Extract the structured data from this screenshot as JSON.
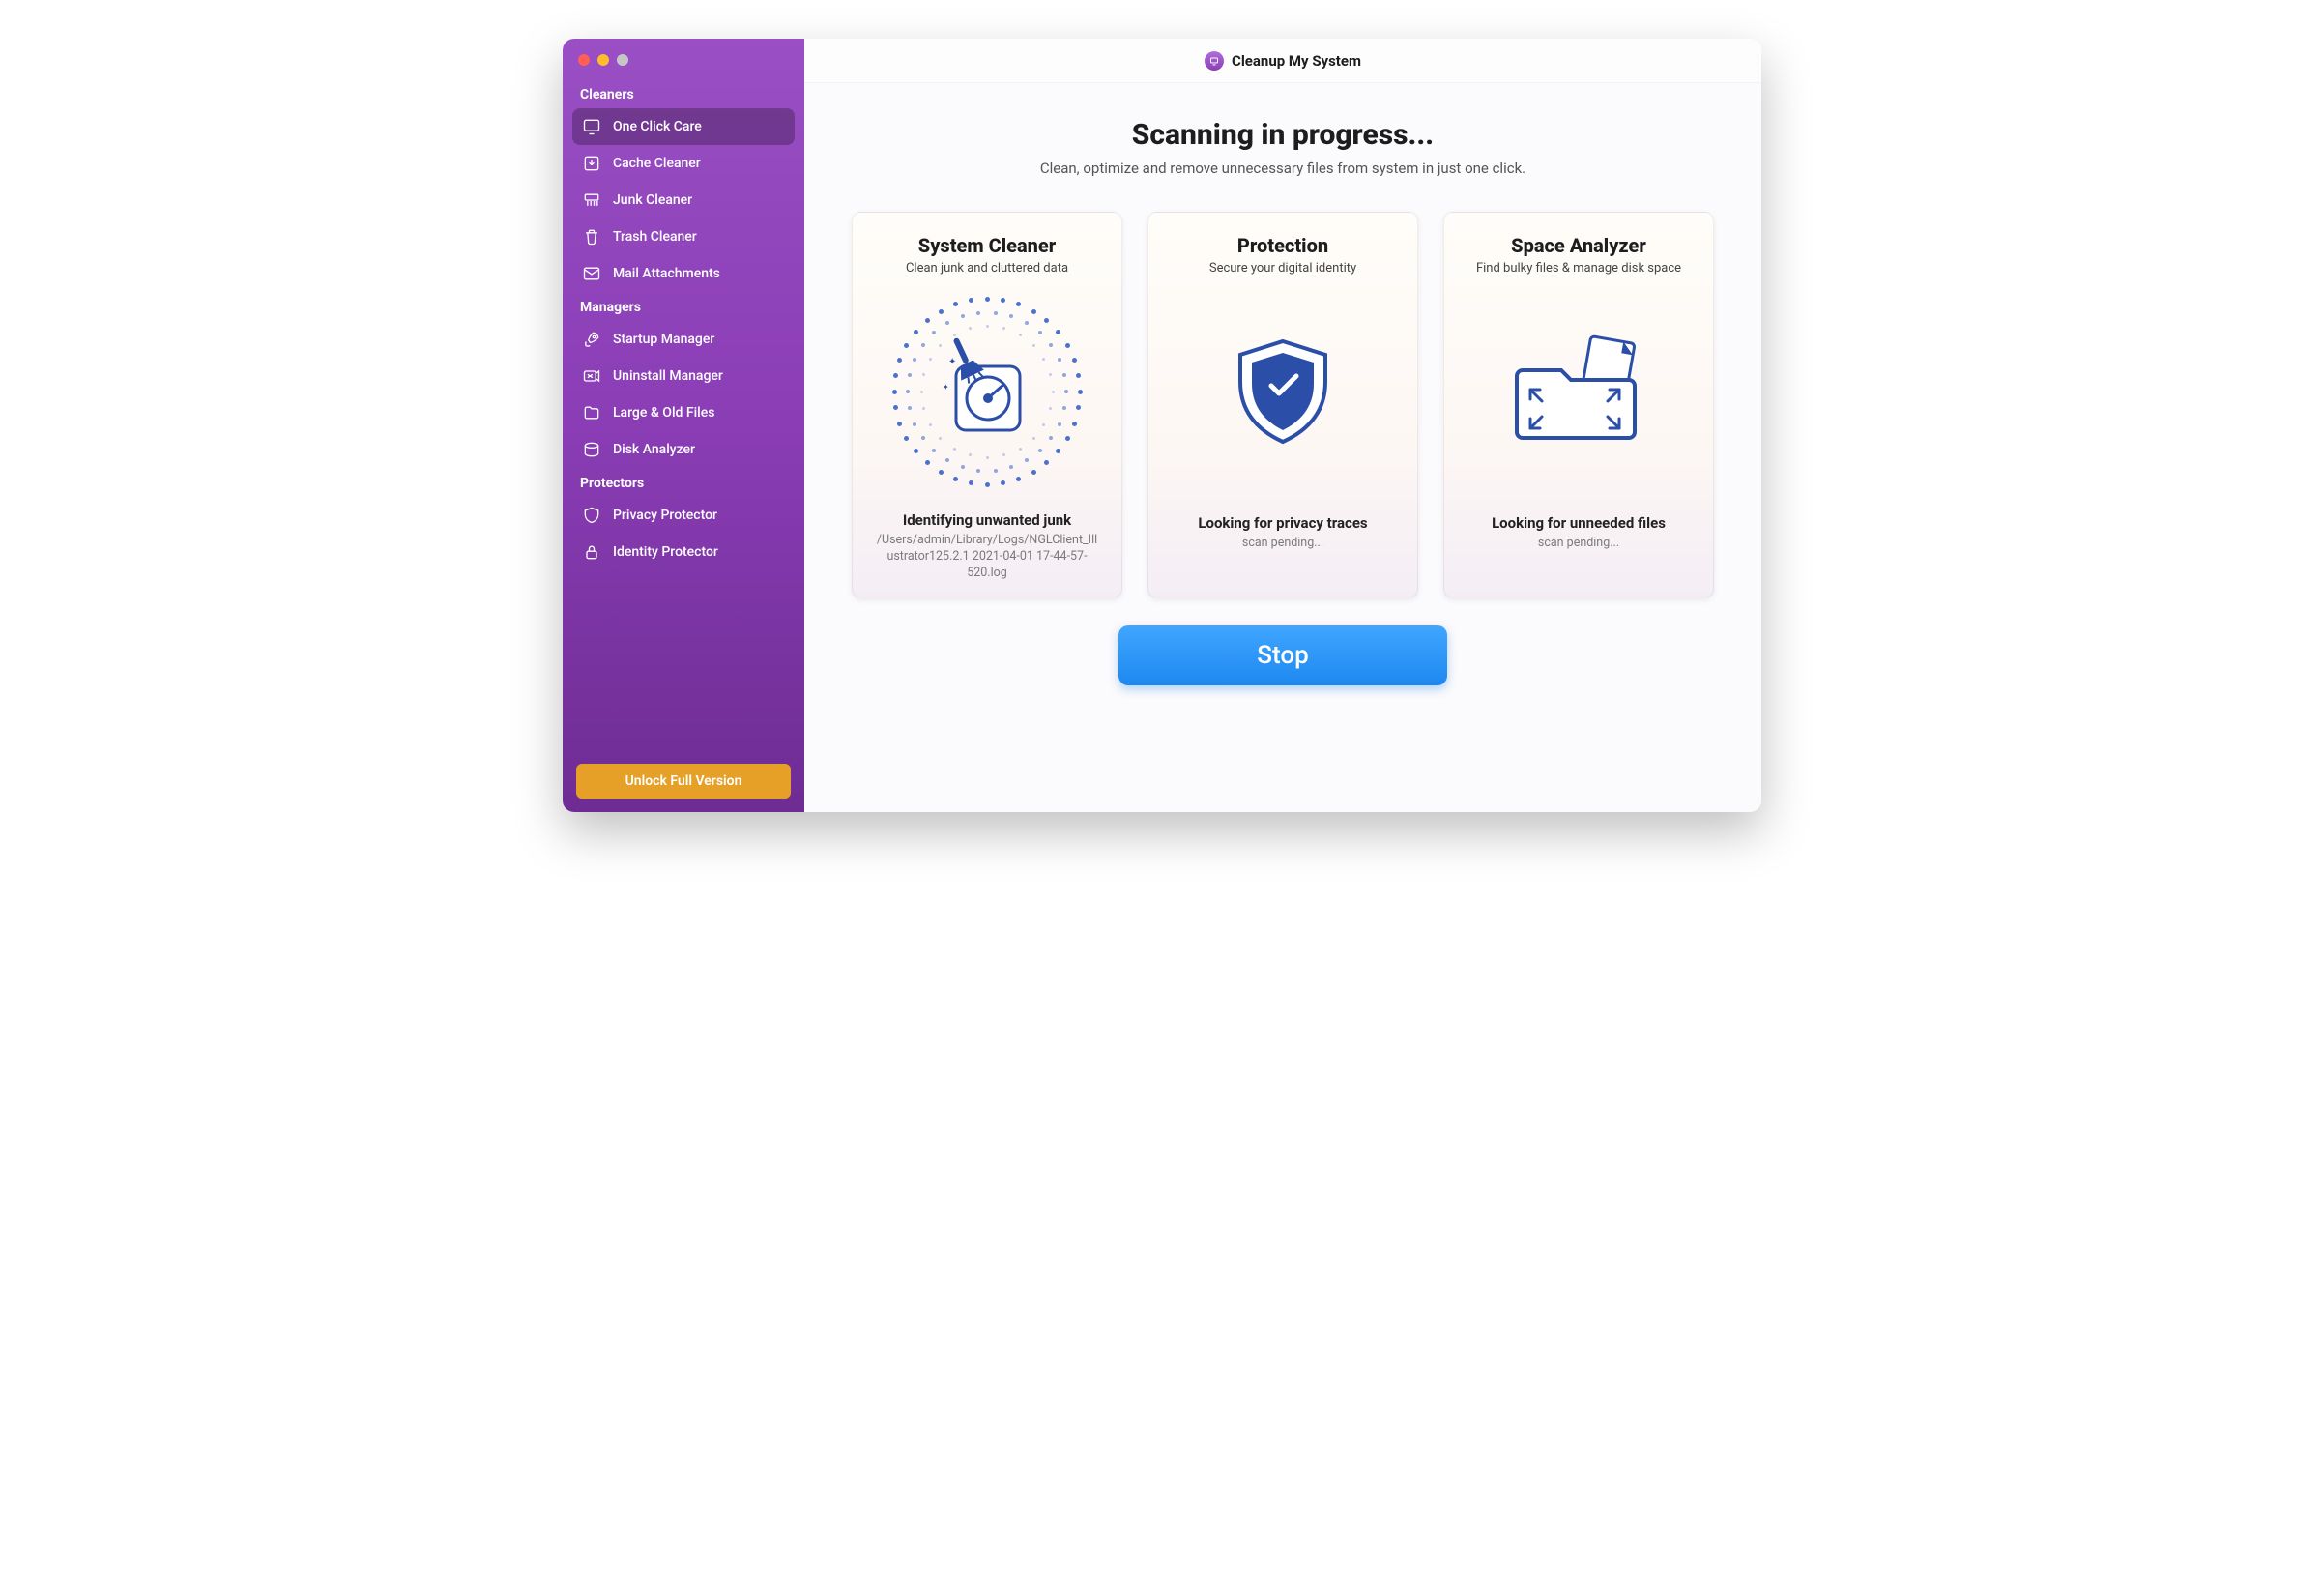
{
  "app": {
    "title": "Cleanup My System"
  },
  "sidebar": {
    "sections": [
      {
        "label": "Cleaners",
        "items": [
          {
            "id": "one-click-care",
            "icon": "monitor",
            "label": "One Click Care",
            "active": true
          },
          {
            "id": "cache-cleaner",
            "icon": "download-box",
            "label": "Cache Cleaner"
          },
          {
            "id": "junk-cleaner",
            "icon": "shredder",
            "label": "Junk Cleaner"
          },
          {
            "id": "trash-cleaner",
            "icon": "trash",
            "label": "Trash Cleaner"
          },
          {
            "id": "mail-attachments",
            "icon": "mail",
            "label": "Mail Attachments"
          }
        ]
      },
      {
        "label": "Managers",
        "items": [
          {
            "id": "startup-manager",
            "icon": "rocket",
            "label": "Startup Manager"
          },
          {
            "id": "uninstall-manager",
            "icon": "uninstall",
            "label": "Uninstall Manager"
          },
          {
            "id": "large-old-files",
            "icon": "files",
            "label": "Large & Old Files"
          },
          {
            "id": "disk-analyzer",
            "icon": "disk",
            "label": "Disk Analyzer"
          }
        ]
      },
      {
        "label": "Protectors",
        "items": [
          {
            "id": "privacy-protector",
            "icon": "shield",
            "label": "Privacy Protector"
          },
          {
            "id": "identity-protector",
            "icon": "lock",
            "label": "Identity Protector"
          }
        ]
      }
    ],
    "unlock_label": "Unlock Full Version"
  },
  "hero": {
    "title": "Scanning in progress...",
    "subtitle": "Clean, optimize and remove unnecessary files from system in just one click."
  },
  "cards": [
    {
      "id": "system-cleaner",
      "title": "System Cleaner",
      "subtitle": "Clean junk and cluttered data",
      "illustration": "disk-broom",
      "status": "Identifying unwanted junk",
      "detail": "/Users/admin/Library/Logs/NGLClient_Illustrator125.2.1 2021-04-01 17-44-57-520.log"
    },
    {
      "id": "protection",
      "title": "Protection",
      "subtitle": "Secure your digital identity",
      "illustration": "shield",
      "status": "Looking for privacy traces",
      "detail": "scan pending..."
    },
    {
      "id": "space-analyzer",
      "title": "Space Analyzer",
      "subtitle": "Find bulky files & manage disk space",
      "illustration": "folder-expand",
      "status": "Looking for unneeded files",
      "detail": "scan pending..."
    }
  ],
  "footer": {
    "stop_label": "Stop"
  }
}
